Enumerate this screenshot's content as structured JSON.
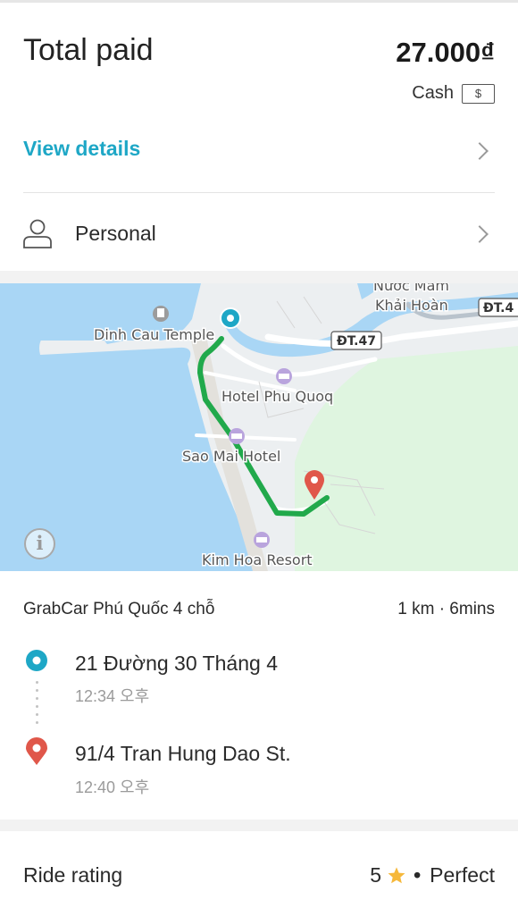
{
  "payment": {
    "total_label": "Total paid",
    "total_amount": "27.000₫",
    "method": "Cash",
    "method_icon": "$"
  },
  "view_details": {
    "label": "View details"
  },
  "profile": {
    "label": "Personal"
  },
  "map": {
    "labels": {
      "nuoc_mam": "Nước Mắm",
      "khai_hoan": "Khải Hoàn",
      "dt4": "ĐT.4",
      "dinh_cau": "Dinh Cau Temple",
      "dt47": "ĐT.47",
      "hotel_phu_quoc": "Hotel Phu Quoq",
      "sao_mai": "Sao Mai Hotel",
      "kim_hoa": "Kim Hoa Resort"
    },
    "colors": {
      "sea": "#a9d6f5",
      "land": "#eceff1",
      "park": "#dff5e0",
      "route": "#21a94b",
      "pickup": "#1ea7c6",
      "dropoff": "#e0574a"
    }
  },
  "trip": {
    "service": "GrabCar Phú Quốc 4 chỗ",
    "distance_duration": "1 km · 6mins",
    "pickup": {
      "address": "21 Đường 30 Tháng 4",
      "time": "12:34 오후"
    },
    "dropoff": {
      "address": "91/4 Tran Hung Dao St.",
      "time": "12:40 오후"
    }
  },
  "rating": {
    "label": "Ride rating",
    "score": "5",
    "bullet": "•",
    "text": "Perfect",
    "star_color": "#f6b83a"
  }
}
